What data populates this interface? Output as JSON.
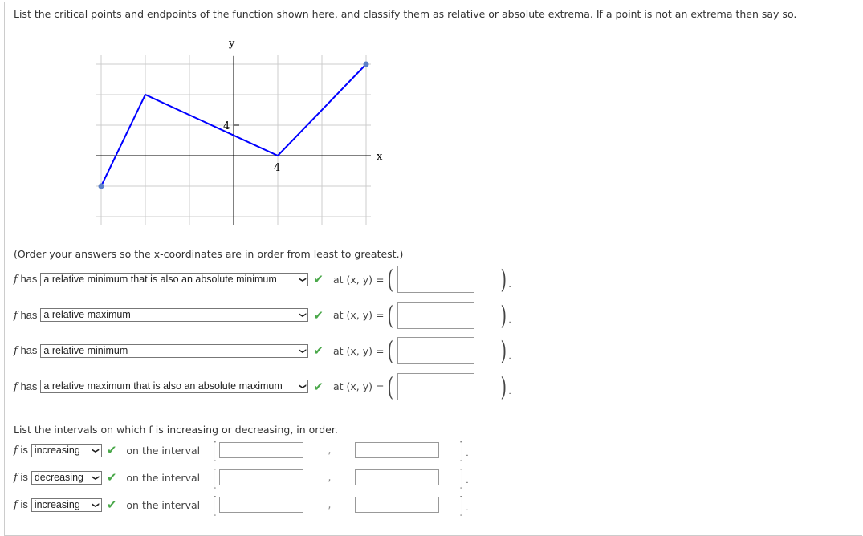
{
  "prompt": "List the critical points and endpoints of the function shown here, and classify them as relative or absolute extrema. If a point is not an extrema then say so.",
  "graph": {
    "x_label": "x",
    "y_label": "y",
    "x_tick": "4",
    "y_tick": "4",
    "grid_step": 4,
    "xlim": [
      -12,
      12
    ],
    "ylim": [
      -8,
      12
    ],
    "points": [
      [
        -12,
        -4
      ],
      [
        -8,
        8
      ],
      [
        4,
        0
      ],
      [
        12,
        12
      ]
    ],
    "endpoints": [
      [
        -12,
        -4
      ],
      [
        12,
        12
      ]
    ],
    "line_color": "#0000ff",
    "endpoint_color": "#5b7fc7"
  },
  "order_note": "(Order your answers so the x-coordinates are in order from least to greatest.)",
  "extrema_rows": [
    {
      "prefix": "has",
      "selected": "a relative minimum that is also an absolute minimum",
      "at": "at  (x, y) =",
      "value": ""
    },
    {
      "prefix": "has",
      "selected": "a relative maximum",
      "at": "at  (x, y) =",
      "value": ""
    },
    {
      "prefix": "has",
      "selected": "a relative minimum",
      "at": "at  (x, y) =",
      "value": ""
    },
    {
      "prefix": "has",
      "selected": "a relative maximum that is also an absolute maximum",
      "at": "at  (x, y) =",
      "value": ""
    }
  ],
  "intervals_prompt": "List the intervals on which f is increasing or decreasing, in order.",
  "interval_rows": [
    {
      "prefix": "is",
      "selected": "increasing",
      "label": "on the interval",
      "start": "",
      "end": ""
    },
    {
      "prefix": "is",
      "selected": "decreasing",
      "label": "on the interval",
      "start": "",
      "end": ""
    },
    {
      "prefix": "is",
      "selected": "increasing",
      "label": "on the interval",
      "start": "",
      "end": ""
    }
  ],
  "f": "f",
  "check_color": "#4aa84a"
}
